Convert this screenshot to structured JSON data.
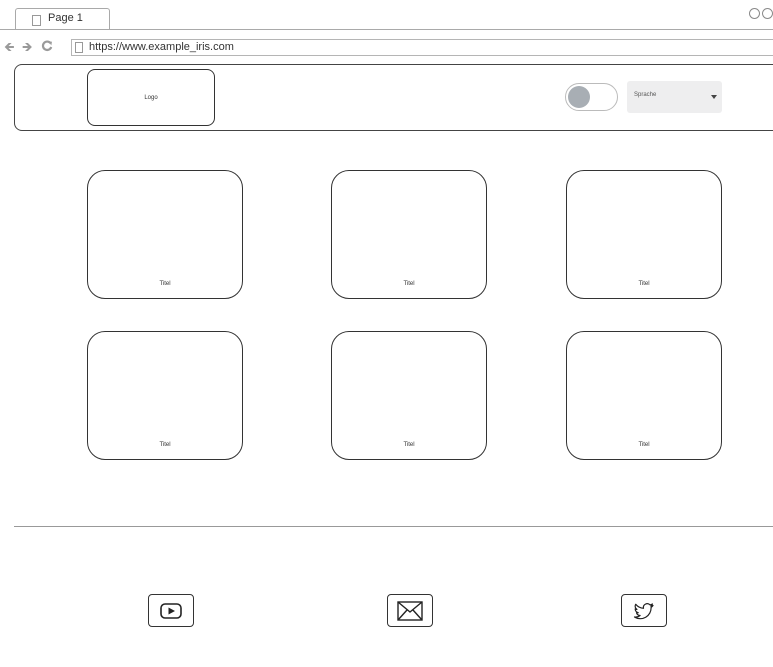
{
  "browser": {
    "tab_label": "Page 1",
    "url": "https://www.example_iris.com",
    "nav_icons": [
      "back-arrow-icon",
      "forward-arrow-icon",
      "reload-icon"
    ]
  },
  "header": {
    "logo_label": "Logo",
    "language_select": {
      "selected": "Sprache"
    },
    "toggle": {
      "state": "off"
    }
  },
  "cards": [
    {
      "title": "Titel"
    },
    {
      "title": "Titel"
    },
    {
      "title": "Titel"
    },
    {
      "title": "Titel"
    },
    {
      "title": "Titel"
    },
    {
      "title": "Titel"
    }
  ],
  "footer": {
    "social_links": [
      {
        "icon": "youtube-play-icon"
      },
      {
        "icon": "mail-icon"
      },
      {
        "icon": "twitter-bird-icon"
      }
    ]
  }
}
